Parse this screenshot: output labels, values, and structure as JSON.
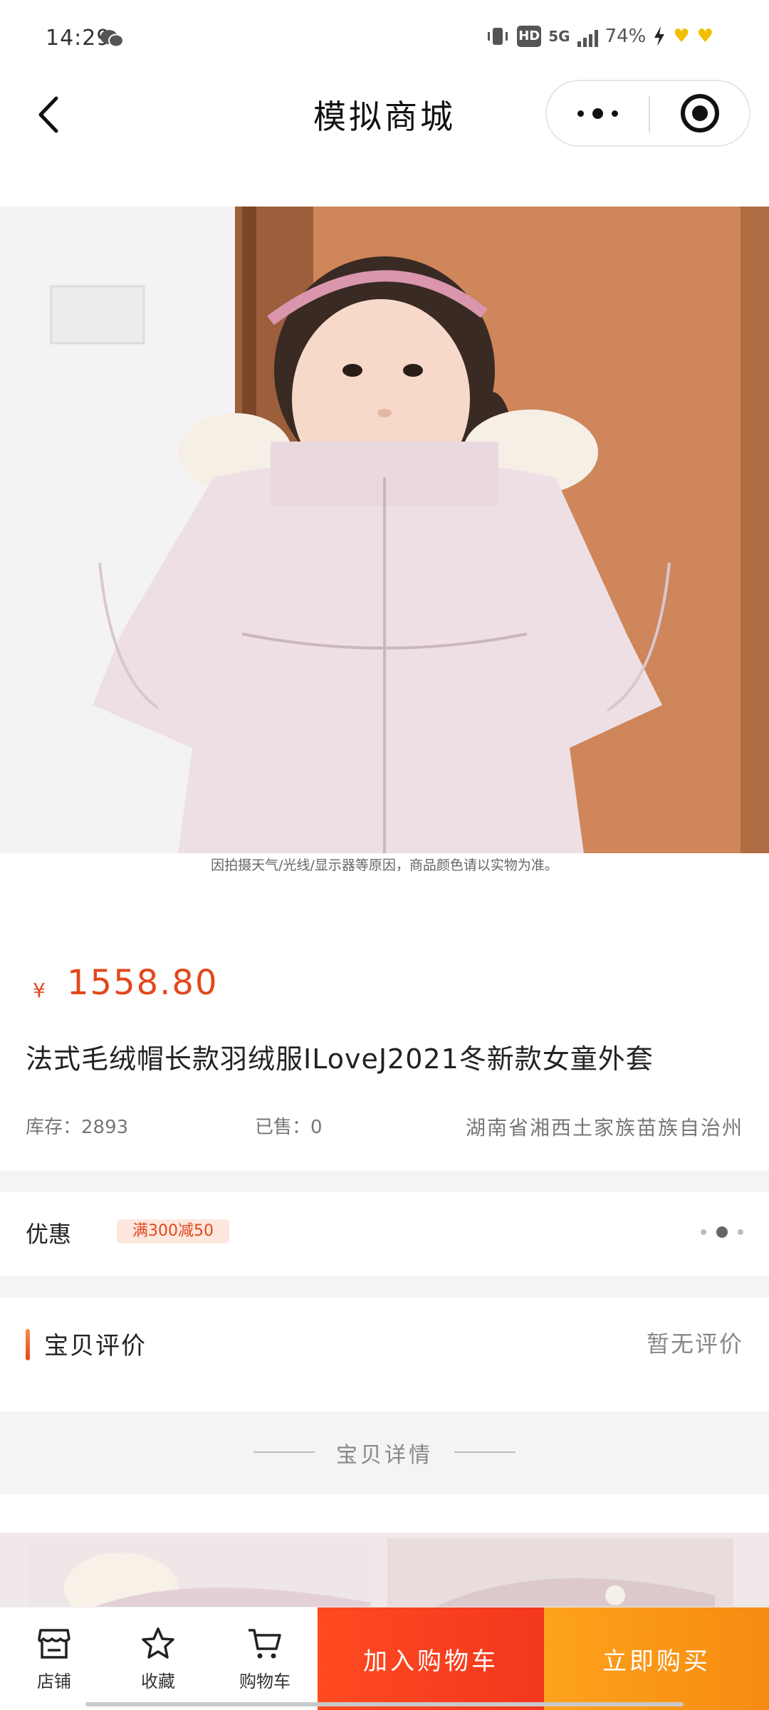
{
  "status_bar": {
    "time": "14:29",
    "hd": "HD",
    "network": "5G",
    "battery": "74%"
  },
  "nav": {
    "title": "模拟商城"
  },
  "product": {
    "disclaimer": "因拍摄天气/光线/显示器等原因，商品颜色请以实物为准。",
    "price_symbol": "¥",
    "price": "1558.80",
    "title": "法式毛绒帽长款羽绒服ILoveJ2021冬新款女童外套",
    "stock": "库存：2893",
    "sold": "已售：0",
    "location": "湖南省湘西土家族苗族自治州"
  },
  "promo": {
    "label": "优惠",
    "badge": "满300减50"
  },
  "reviews": {
    "title": "宝贝评价",
    "empty": "暂无评价"
  },
  "details": {
    "title": "宝贝详情"
  },
  "bottom_bar": {
    "shop": "店铺",
    "favorite": "收藏",
    "cart": "购物车",
    "add_to_cart": "加入购物车",
    "buy_now": "立即购买"
  },
  "colors": {
    "accent": "#e2481c",
    "add_to_cart_bg": "#f2381e",
    "buy_now_bg": "#f78b12"
  }
}
